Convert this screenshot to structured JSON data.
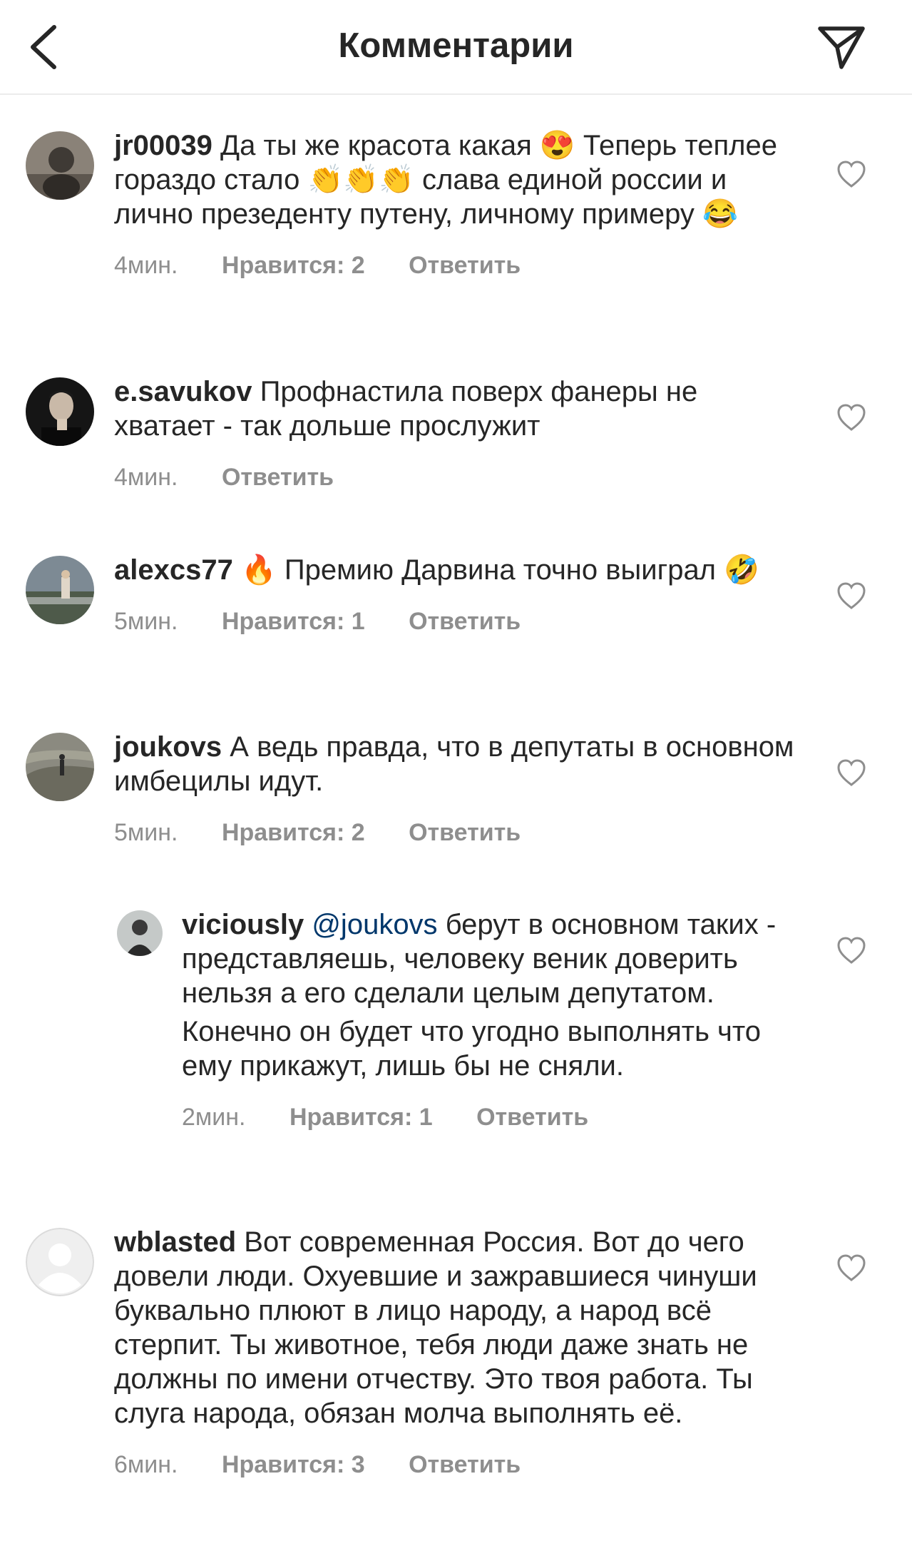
{
  "header": {
    "title": "Комментарии"
  },
  "icons": {
    "back": "chevron-left-icon",
    "send": "paper-plane-icon",
    "like": "heart-outline-icon"
  },
  "colors": {
    "text": "#262626",
    "secondary": "#8e8e8e",
    "mention": "#00376b",
    "divider": "#ececec"
  },
  "comments": [
    {
      "username": "jr00039",
      "text_a": "Да ты же красота какая",
      "emoji_a": "😍",
      "text_b": "Теперь теплее гораздо стало",
      "emoji_b": "👏👏👏",
      "text_c": "слава единой россии и лично презеденту путену, личному примеру",
      "emoji_c": "😂",
      "time": "4мин.",
      "likes": "Нравится: 2",
      "reply": "Ответить"
    },
    {
      "username": "e.savukov",
      "text": "Профнастила поверх фанеры не хватает - так  дольше прослужит",
      "time": "4мин.",
      "reply": "Ответить"
    },
    {
      "username": "alexcs77",
      "emoji_a": "🔥",
      "text": "Премию Дарвина точно выиграл",
      "emoji_b": "🤣",
      "time": "5мин.",
      "likes": "Нравится: 1",
      "reply": "Ответить"
    },
    {
      "username": "joukovs",
      "text": "А ведь правда, что в депутаты в основном имбецилы идут.",
      "time": "5мин.",
      "likes": "Нравится: 2",
      "reply": "Ответить"
    },
    {
      "username": "viciously",
      "mention": "@joukovs",
      "text": "берут в основном таких - представляешь, человеку веник доверить нельзя а его сделали целым депутатом.",
      "text_2": "Конечно он будет что угодно выполнять что ему прикажут, лишь бы не сняли.",
      "time": "2мин.",
      "likes": "Нравится: 1",
      "reply": "Ответить"
    },
    {
      "username": "wblasted",
      "text": "Вот современная Россия. Вот до чего довели люди. Охуевшие и зажравшиеся чинуши буквально плюют в лицо народу, а народ всё стерпит. Ты животное, тебя люди даже знать не должны по имени отчеству. Это твоя работа. Ты слуга народа, обязан молча выполнять её.",
      "time": "6мин.",
      "likes": "Нравится: 3",
      "reply": "Ответить"
    }
  ]
}
